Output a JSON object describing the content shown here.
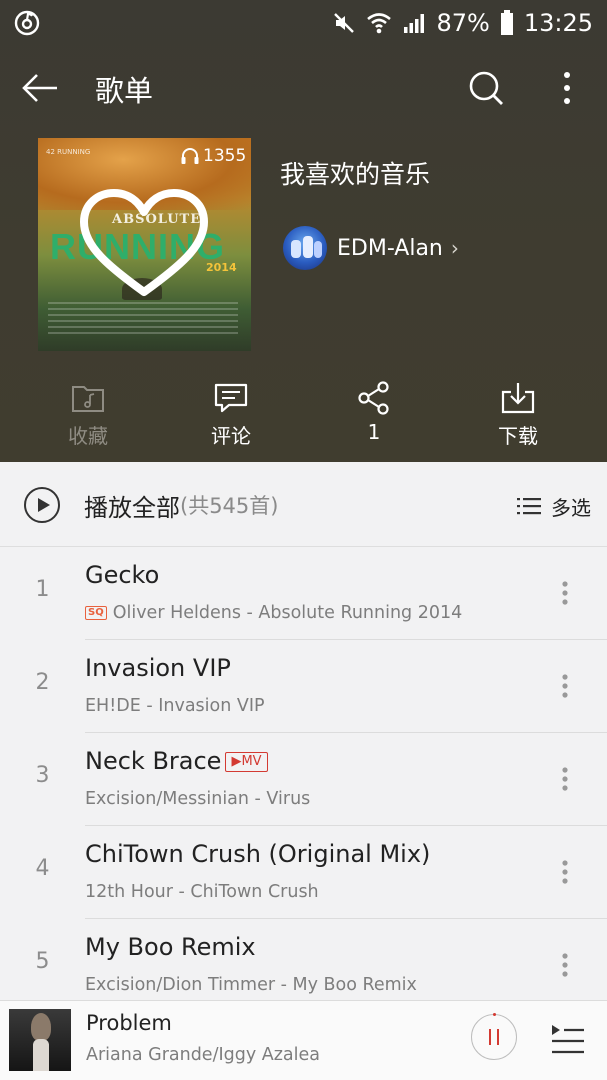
{
  "status_bar": {
    "battery_percent": "87%",
    "time": "13:25"
  },
  "topbar": {
    "title": "歌单"
  },
  "playlist": {
    "title": "我喜欢的音乐",
    "play_count": "1355",
    "creator_name": "EDM-Alan",
    "cover": {
      "absolute": "ABSOLUTE",
      "running": "RUNNING",
      "year": "2014",
      "cd_label": "42 RUNNING"
    }
  },
  "actions": [
    {
      "label": "收藏",
      "icon": "folder-music-icon",
      "enabled": false
    },
    {
      "label": "评论",
      "icon": "comment-icon",
      "enabled": true
    },
    {
      "label": "1",
      "icon": "share-icon",
      "enabled": true
    },
    {
      "label": "下载",
      "icon": "download-icon",
      "enabled": true
    }
  ],
  "play_all": {
    "label": "播放全部",
    "count": "(共545首)",
    "multiselect_label": "多选"
  },
  "songs": [
    {
      "index": "1",
      "title": "Gecko",
      "subtitle": "Oliver Heldens - Absolute Running 2014",
      "sq": "SQ",
      "mv": ""
    },
    {
      "index": "2",
      "title": "Invasion VIP",
      "subtitle": "EH!DE - Invasion VIP",
      "sq": "",
      "mv": ""
    },
    {
      "index": "3",
      "title": "Neck Brace",
      "subtitle": "Excision/Messinian - Virus",
      "sq": "",
      "mv": "▶MV"
    },
    {
      "index": "4",
      "title": "ChiTown Crush (Original Mix)",
      "subtitle": "12th Hour - ChiTown Crush",
      "sq": "",
      "mv": ""
    },
    {
      "index": "5",
      "title": "My Boo Remix",
      "subtitle": "Excision/Dion Timmer - My Boo Remix",
      "sq": "",
      "mv": ""
    }
  ],
  "now_playing": {
    "title": "Problem",
    "artist": "Ariana Grande/Iggy Azalea",
    "state": "playing"
  },
  "colors": {
    "header_bg": "#3f3c31",
    "accent_red": "#d33a32",
    "sq_badge": "#e8613d",
    "list_bg": "#f2f2f3"
  }
}
